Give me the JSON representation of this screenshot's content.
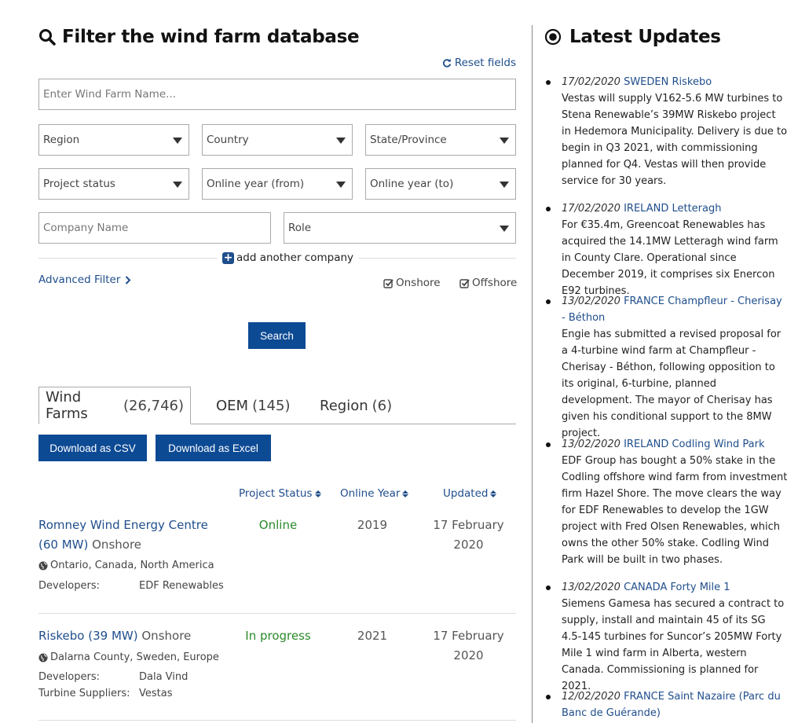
{
  "filter": {
    "title": "Filter the wind farm database",
    "reset_label": "Reset fields",
    "name_placeholder": "Enter Wind Farm Name...",
    "selects": {
      "region": "Region",
      "country": "Country",
      "state": "State/Province",
      "project_status": "Project status",
      "year_from": "Online year (from)",
      "year_to": "Online year (to)",
      "role": "Role"
    },
    "company_placeholder": "Company Name",
    "add_company_label": "add another company",
    "advanced_label": "Advanced Filter",
    "onshore_label": "Onshore",
    "offshore_label": "Offshore",
    "search_label": "Search"
  },
  "results": {
    "tabs": [
      {
        "label": "Wind Farms",
        "count": "(26,746)"
      },
      {
        "label": "OEM",
        "count": "(145)"
      },
      {
        "label": "Region",
        "count": "(6)"
      }
    ],
    "download_csv": "Download as CSV",
    "download_excel": "Download as Excel",
    "columns": {
      "project_status": "Project Status",
      "online_year": "Online Year",
      "updated": "Updated"
    },
    "rows": [
      {
        "name": "Romney Wind Energy Centre (60 MW)",
        "type": "Onshore",
        "location": "Ontario, Canada, North America",
        "status": "Online",
        "year": "2019",
        "updated": "17 February 2020",
        "meta": [
          {
            "key": "Developers:",
            "value": "EDF Renewables"
          }
        ]
      },
      {
        "name": "Riskebo (39 MW)",
        "type": "Onshore",
        "location": "Dalarna County, Sweden, Europe",
        "status": "In progress",
        "year": "2021",
        "updated": "17 February 2020",
        "meta": [
          {
            "key": "Developers:",
            "value": "Dala Vind"
          },
          {
            "key": "Turbine Suppliers:",
            "value": "Vestas"
          }
        ]
      }
    ]
  },
  "updates": {
    "title": "Latest Updates",
    "items": [
      {
        "date": "17/02/2020",
        "headline": "SWEDEN Riskebo",
        "text": "Vestas will supply V162-5.6 MW turbines to Stena Renewable’s 39MW Riskebo project in Hedemora Municipality. Delivery is due to begin in Q3 2021, with commissioning planned for Q4. Vestas will then provide service for 30 years."
      },
      {
        "date": "17/02/2020",
        "headline": "IRELAND Letteragh",
        "text": "For €35.4m, Greencoat Renewables has acquired the 14.1MW Letteragh wind farm in County Clare. Operational since December 2019, it comprises six Enercon E92 turbines."
      },
      {
        "date": "13/02/2020",
        "headline": "FRANCE Champfleur - Cherisay - Béthon",
        "text": "Engie has submitted a revised proposal for a 4-turbine wind farm at Champfleur - Cherisay - Béthon, following opposition to its original, 6-turbine, planned development. The mayor of Cherisay has given his conditional support to the 8MW project."
      },
      {
        "date": "13/02/2020",
        "headline": "IRELAND Codling Wind Park",
        "text": "EDF Group has bought a 50% stake in the Codling offshore wind farm from investment firm Hazel Shore. The move clears the way for EDF Renewables to develop the 1GW project with Fred Olsen Renewables, which owns the other 50% stake. Codling Wind Park will be built in two phases."
      },
      {
        "date": "13/02/2020",
        "headline": "CANADA Forty Mile 1",
        "text": "Siemens Gamesa has secured a contract to supply, install and maintain 45 of its SG 4.5-145 turbines for Suncor’s 205MW Forty Mile 1 wind farm in Alberta, western Canada. Commissioning is planned for 2021."
      },
      {
        "date": "12/02/2020",
        "headline": "FRANCE Saint Nazaire (Parc du Banc de Guérande)",
        "text": ""
      }
    ]
  }
}
